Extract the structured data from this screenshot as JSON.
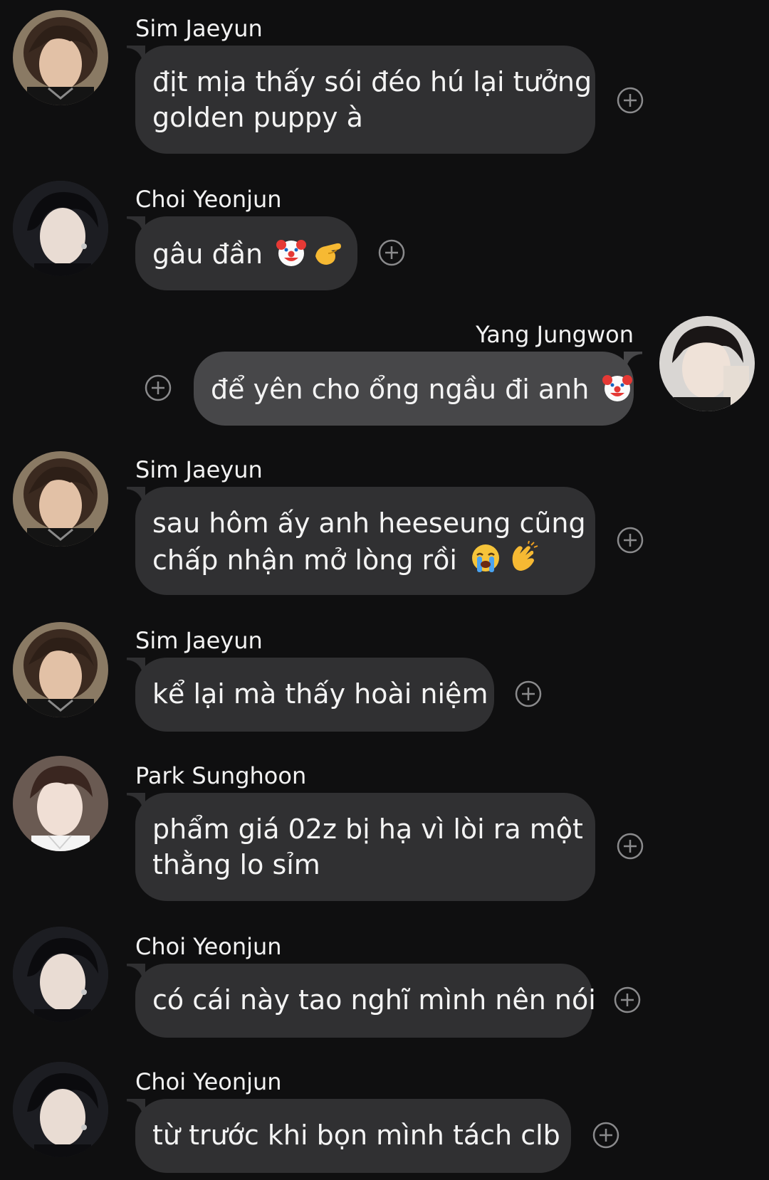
{
  "messages": [
    {
      "sender": "Sim Jaeyun",
      "lines": [
        "địt mịa thấy sói đéo hú lại tưởng",
        "golden puppy à"
      ],
      "emoji": [],
      "side": "left"
    },
    {
      "sender": "Choi Yeonjun",
      "lines": [
        "gâu đần "
      ],
      "emoji": [
        "clown-face-emoji",
        "pinching-hand-emoji"
      ],
      "side": "left"
    },
    {
      "sender": "Yang Jungwon",
      "lines": [
        "để yên cho ổng ngầu đi anh "
      ],
      "emoji": [
        "clown-face-emoji"
      ],
      "side": "right"
    },
    {
      "sender": "Sim Jaeyun",
      "lines": [
        "sau hôm ấy anh heeseung cũng",
        "chấp nhận mở lòng rồi "
      ],
      "emoji": [
        "loudly-crying-face-emoji",
        "clapping-hands-emoji"
      ],
      "side": "left"
    },
    {
      "sender": "Sim Jaeyun",
      "lines": [
        "kể lại mà thấy hoài niệm"
      ],
      "emoji": [],
      "side": "left"
    },
    {
      "sender": "Park Sunghoon",
      "lines": [
        "phẩm giá 02z bị hạ vì lòi ra một",
        "thằng lo sỉm"
      ],
      "emoji": [],
      "side": "left"
    },
    {
      "sender": "Choi Yeonjun",
      "lines": [
        "có cái này tao nghĩ mình nên nói"
      ],
      "emoji": [],
      "side": "left"
    },
    {
      "sender": "Choi Yeonjun",
      "lines": [
        "từ trước khi bọn mình tách clb"
      ],
      "emoji": [],
      "side": "left"
    }
  ],
  "icons": {
    "add_reaction": "plus-circle-icon"
  },
  "colors": {
    "background": "#0f0f10",
    "bubble_theirs": "#303032",
    "bubble_mine": "#474749",
    "text": "#f4f4f4"
  }
}
